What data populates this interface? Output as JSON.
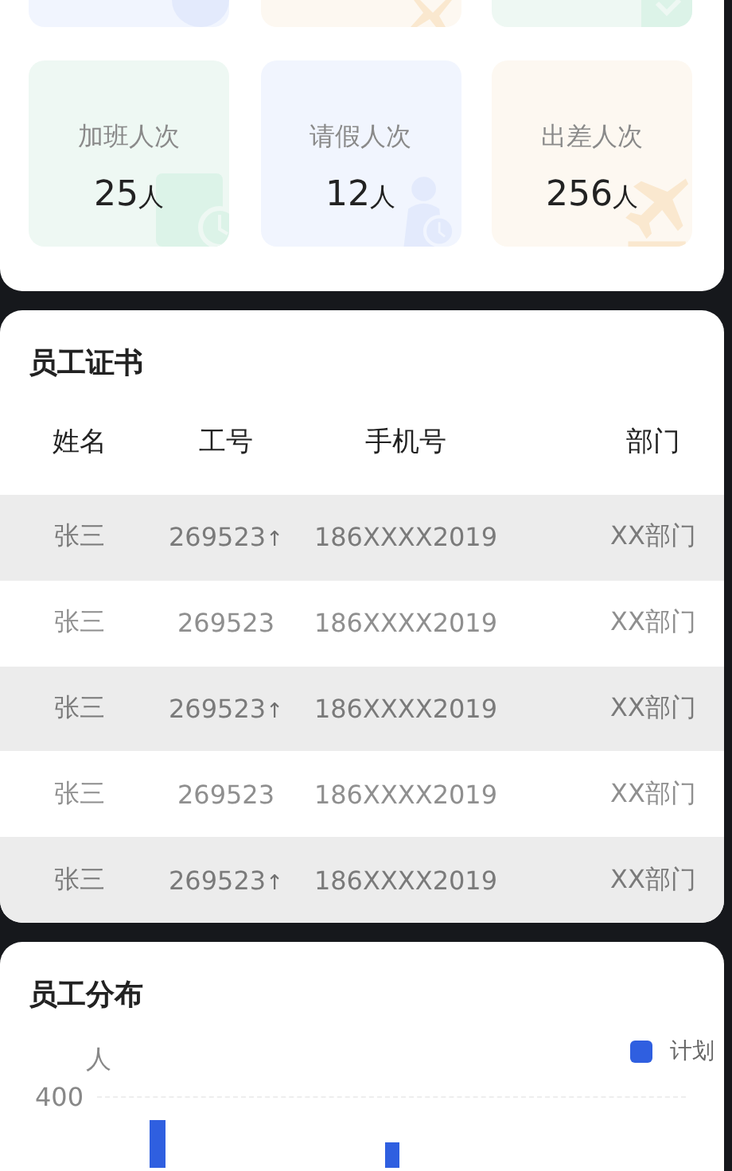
{
  "stats": [
    {
      "kind": "overtime",
      "label": "加班人次",
      "value": "25",
      "unit": "人"
    },
    {
      "kind": "leave",
      "label": "请假人次",
      "value": "12",
      "unit": "人"
    },
    {
      "kind": "trip",
      "label": "出差人次",
      "value": "256",
      "unit": "人"
    }
  ],
  "certificates": {
    "title": "员工证书",
    "columns": [
      "姓名",
      "工号",
      "手机号",
      "部门"
    ],
    "rows": [
      {
        "shaded": true,
        "cells": [
          "张三",
          "269523",
          "186XXXX2019",
          "XX部门"
        ],
        "marker": "↑"
      },
      {
        "shaded": false,
        "cells": [
          "张三",
          "269523",
          "186XXXX2019",
          "XX部门"
        ]
      },
      {
        "shaded": true,
        "cells": [
          "张三",
          "269523",
          "186XXXX2019",
          "XX部门"
        ],
        "marker": "↑"
      },
      {
        "shaded": false,
        "cells": [
          "张三",
          "269523",
          "186XXXX2019",
          "XX部门"
        ]
      },
      {
        "shaded": true,
        "cells": [
          "张三",
          "269523",
          "186XXXX2019",
          "XX部门"
        ],
        "marker": "↑"
      }
    ]
  },
  "distribution": {
    "title": "员工分布",
    "legend": "计划",
    "unit": "人",
    "tick": "400"
  }
}
